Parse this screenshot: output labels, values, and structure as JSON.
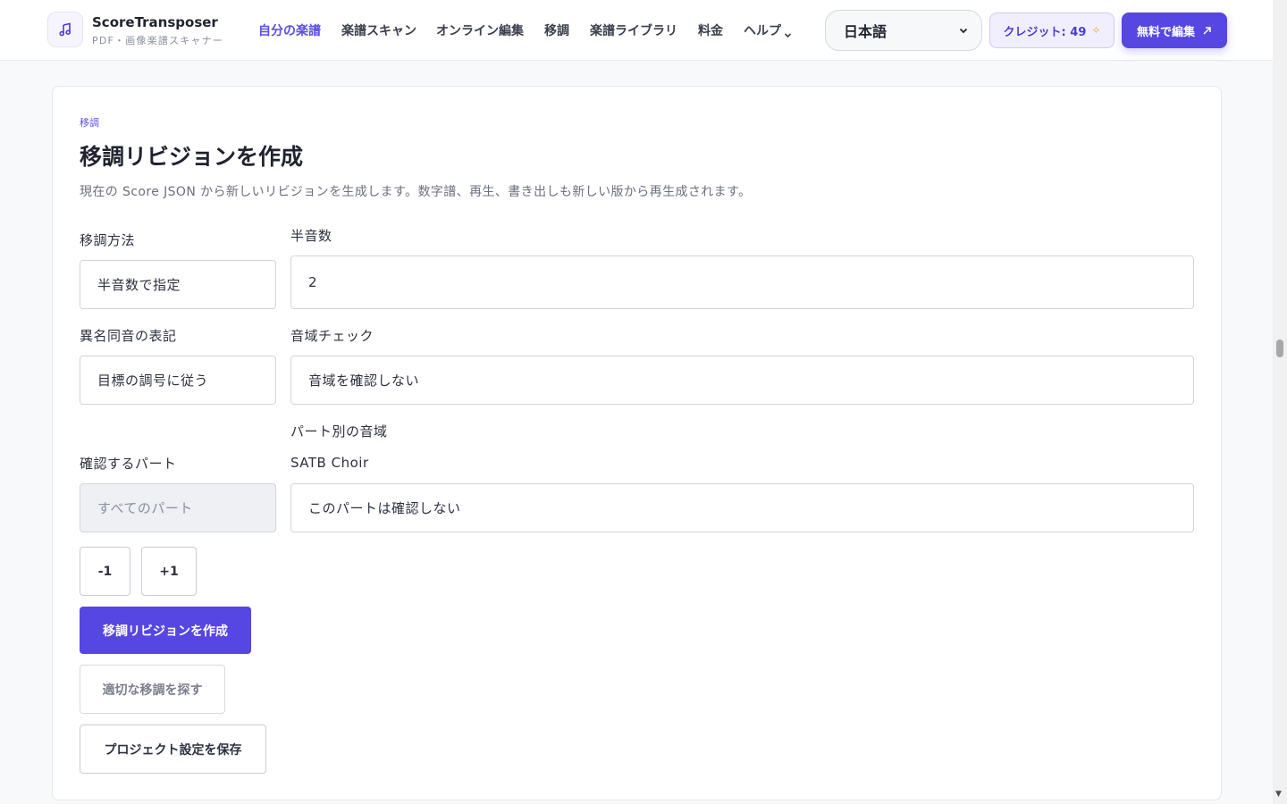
{
  "header": {
    "brand_name": "ScoreTransposer",
    "brand_sub": "PDF・画像楽譜スキャナー",
    "logo_icon": "music-note-icon",
    "nav": [
      {
        "label": "自分の楽譜",
        "active": true
      },
      {
        "label": "楽譜スキャン"
      },
      {
        "label": "オンライン編集"
      },
      {
        "label": "移調"
      },
      {
        "label": "楽譜ライブラリ"
      },
      {
        "label": "料金"
      },
      {
        "label": "ヘルプ"
      }
    ],
    "language": "日本語",
    "credits_label": "クレジット: 49",
    "cta_label": "無料で編集"
  },
  "form": {
    "eyebrow": "移調",
    "title": "移調リビジョンを作成",
    "description": "現在の Score JSON から新しいリビジョンを生成します。数字譜、再生、書き出しも新しい版から再生成されます。",
    "method_label": "移調方法",
    "method_value": "半音数で指定",
    "semitones_label": "半音数",
    "semitones_value": "2",
    "enharmonic_label": "異名同音の表記",
    "enharmonic_value": "目標の調号に従う",
    "range_check_label": "音域チェック",
    "range_check_value": "音域を確認しない",
    "part_range_label": "パート別の音域",
    "part_name": "SATB Choir",
    "parts_label": "確認するパート",
    "parts_value": "すべてのパート",
    "part_range_value": "このパートは確認しない",
    "minus_label": "-1",
    "plus_label": "+1",
    "create_label": "移調リビジョンを作成",
    "find_label": "適切な移調を探す",
    "save_label": "プロジェクト設定を保存"
  },
  "colors": {
    "accent": "#5646e2",
    "accent_text": "#5b4fe0"
  }
}
